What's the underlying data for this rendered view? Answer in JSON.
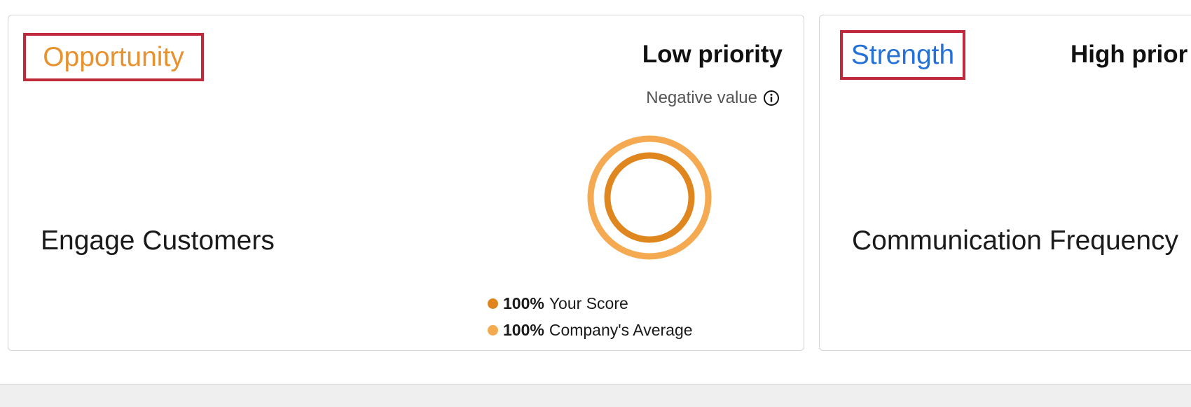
{
  "colors": {
    "opportunity": "#e8922f",
    "strength": "#2471d8",
    "your_score": "#e0861f",
    "company_average": "#f5aa52",
    "highlight_box": "#c0293a"
  },
  "cards": [
    {
      "category": "Opportunity",
      "priority": "Low priority",
      "value_label": "Negative value",
      "value_icon": "info-icon",
      "metric": "Engage Customers",
      "scores": [
        {
          "value": "100%",
          "label": "Your Score",
          "fraction": 1.0
        },
        {
          "value": "100%",
          "label": "Company's Average",
          "fraction": 1.0
        }
      ]
    },
    {
      "category": "Strength",
      "priority": "High prior",
      "metric": "Communication Frequency"
    }
  ]
}
